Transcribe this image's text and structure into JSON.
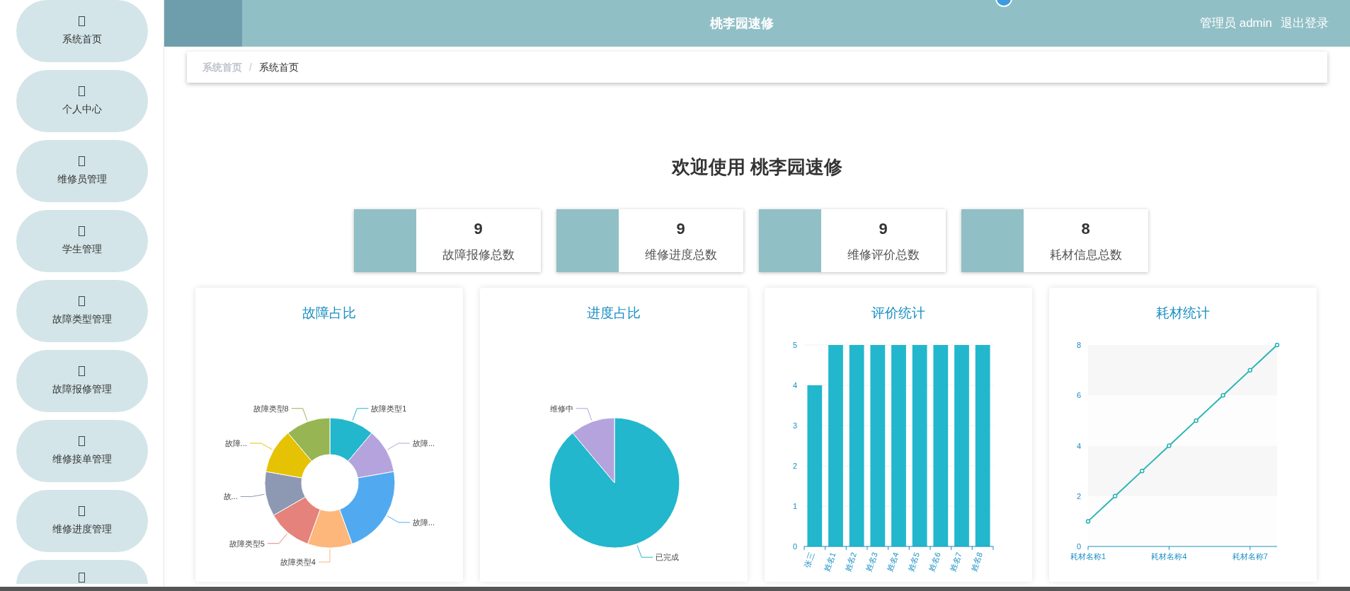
{
  "sidebar": {
    "items": [
      {
        "kind": "labeled",
        "label": "系统首页"
      },
      {
        "kind": "labeled",
        "label": "个人中心"
      },
      {
        "kind": "labeled",
        "label": "维修员管理"
      },
      {
        "kind": "labeled",
        "label": "学生管理"
      },
      {
        "kind": "labeled",
        "label": "故障类型管理"
      },
      {
        "kind": "labeled",
        "label": "故障报修管理"
      },
      {
        "kind": "labeled",
        "label": "维修接单管理"
      },
      {
        "kind": "labeled",
        "label": "维修进度管理"
      },
      {
        "kind": "icon_only"
      }
    ]
  },
  "header": {
    "title": "桃李园速修",
    "user": "管理员 admin",
    "logout": "退出登录"
  },
  "breadcrumb": {
    "items": [
      "系统首页",
      "系统首页"
    ],
    "separator": "/"
  },
  "welcome": "欢迎使用 桃李园速修",
  "stats": [
    {
      "value": "9",
      "label": "故障报修总数"
    },
    {
      "value": "9",
      "label": "维修进度总数"
    },
    {
      "value": "9",
      "label": "维修评价总数"
    },
    {
      "value": "8",
      "label": "耗材信息总数"
    }
  ],
  "charts": [
    {
      "title": "故障占比",
      "chart_data": {
        "type": "donut",
        "categories": [
          "故障类型1",
          "故障...",
          "故障...",
          "故障类型4",
          "故障类型5",
          "故...",
          "故障...",
          "故障类型8"
        ],
        "colors": [
          "#22b7cc",
          "#b4a3dc",
          "#51aaf0",
          "#fdb77a",
          "#e4827b",
          "#8d98b3",
          "#e5c204",
          "#97b552"
        ],
        "values": [
          11.11,
          11.11,
          22.23,
          11.11,
          11.11,
          11.11,
          11.11,
          11.11
        ]
      }
    },
    {
      "title": "进度占比",
      "chart_data": {
        "type": "pie",
        "categories": [
          "已完成",
          "维修中"
        ],
        "colors": [
          "#22b7cc",
          "#b4a3dc"
        ],
        "values": [
          88.9,
          11.1
        ]
      }
    },
    {
      "title": "评价统计",
      "chart_data": {
        "type": "bar",
        "categories": [
          "张三",
          "姓名1",
          "姓名2",
          "姓名3",
          "姓名4",
          "姓名5",
          "姓名6",
          "姓名7",
          "姓名8"
        ],
        "series": [
          {
            "color": "#22b7cc",
            "values": [
              4,
              5,
              5,
              5,
              5,
              5,
              5,
              5,
              5
            ]
          }
        ],
        "grid": true,
        "ylim": [
          0,
          5
        ],
        "yticks": [
          0,
          1,
          2,
          3,
          4,
          5
        ]
      }
    },
    {
      "title": "耗材统计",
      "chart_data": {
        "type": "line",
        "categories": [
          "耗材名称1",
          null,
          null,
          "耗材名称4",
          null,
          null,
          "耗材名称7",
          null
        ],
        "series": [
          {
            "color": "#2ab4b4",
            "marker": true,
            "values": [
              1,
              2,
              3,
              4,
              5,
              6,
              7,
              8
            ]
          }
        ],
        "ylim": [
          0,
          8
        ],
        "yticks": [
          0,
          2,
          4,
          6,
          8
        ]
      }
    }
  ]
}
